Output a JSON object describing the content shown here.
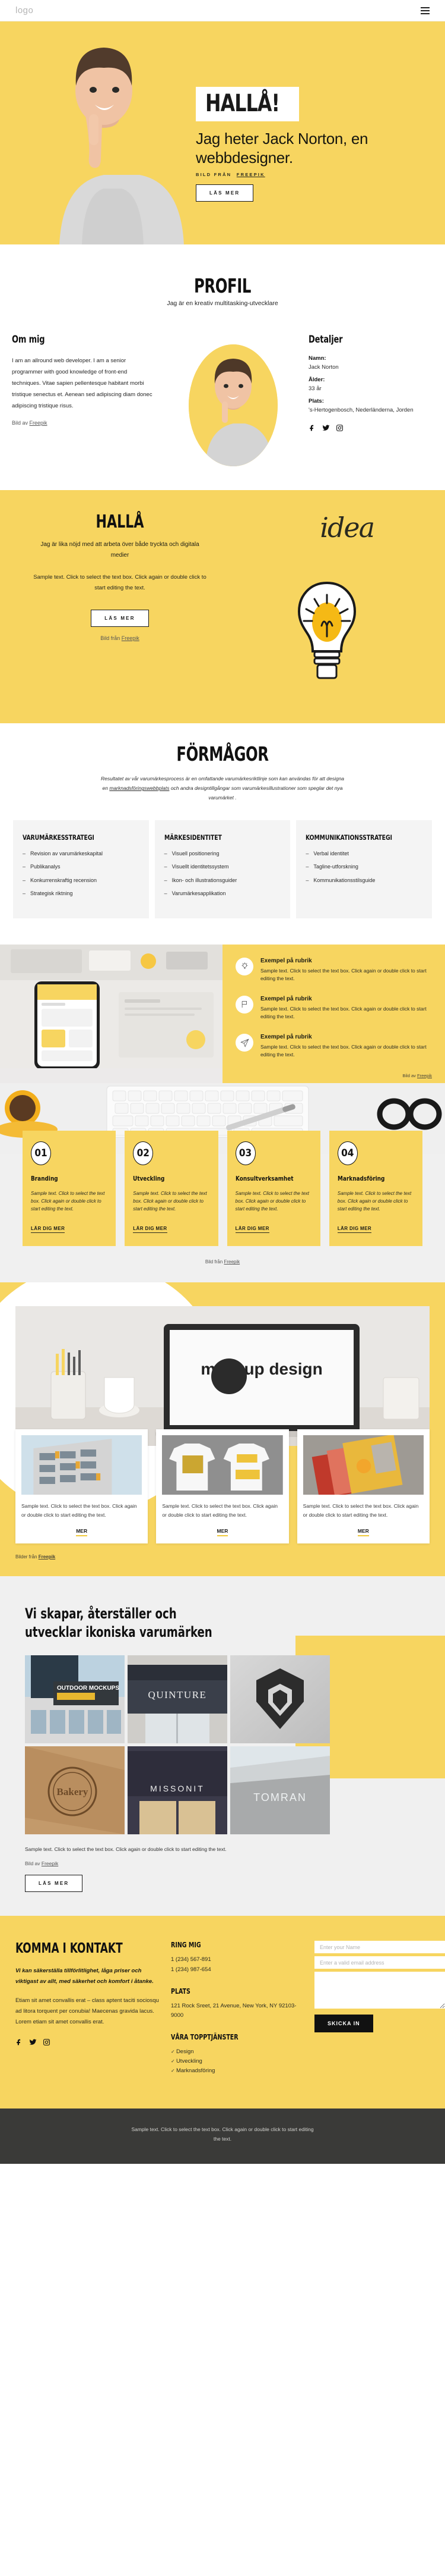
{
  "header": {
    "logo": "logo",
    "menu_icon": "hamburger-menu"
  },
  "hero": {
    "badge": "HALLÅ!",
    "headline": "Jag heter Jack Norton, en webbdesigner.",
    "credit_prefix": "BILD FRÅN",
    "credit_link": "FREEPIK",
    "cta": "LÄS MER"
  },
  "profil": {
    "title": "PROFIL",
    "subtitle": "Jag är en kreativ multitasking-utvecklare",
    "about_heading": "Om mig",
    "about_text": "I am an allround web developer. I am a senior programmer with good knowledge of front-end techniques. Vitae sapien pellentesque habitant morbi tristique senectus et. Aenean sed adipiscing diam donec adipiscing tristique risus.",
    "about_credit_prefix": "Bild av ",
    "about_credit_link": "Freepik",
    "details_heading": "Detaljer",
    "details": [
      {
        "key": "Namn:",
        "value": "Jack Norton"
      },
      {
        "key": "Ålder:",
        "value": "33 år"
      },
      {
        "key": "Plats:",
        "value": "'s-Hertogenbosch, Nederländerna, Jorden"
      }
    ],
    "socials": [
      "facebook-icon",
      "twitter-icon",
      "instagram-icon"
    ]
  },
  "halla": {
    "title": "HALLÅ",
    "tagline": "Jag är lika nöjd med att arbeta över både tryckta och digitala medier",
    "body": "Sample text. Click to select the text box. Click again or double click to start editing the text.",
    "cta": "LÄS MER",
    "credit_prefix": "Bild från ",
    "credit_link": "Freepik",
    "idea_word": "idea"
  },
  "formagor": {
    "title": "FÖRMÅGOR",
    "subtitle_a": "Resultatet av vår varumärkesprocess är en omfattande varumärkesriktlinje som kan användas för att designa en ",
    "subtitle_link": "marknadsföringswebbplats",
    "subtitle_b": " och andra designtillgångar som varumärkesillustrationer som speglar det nya varumärket .",
    "cards": [
      {
        "heading": "VARUMÄRKESSTRATEGI",
        "items": [
          "Revision av varumärkeskapital",
          "Publikanalys",
          "Konkurrenskraftig recension",
          "Strategisk riktning"
        ]
      },
      {
        "heading": "MÄRKESIDENTITET",
        "items": [
          "Visuell positionering",
          "Visuellt identitetssystem",
          "Ikon- och illustrationsguider",
          "Varumärkesapplikation"
        ]
      },
      {
        "heading": "KOMMUNIKATIONSSTRATEGI",
        "items": [
          "Verbal identitet",
          "Tagline-utforskning",
          "Kommunikationsstilsguide"
        ]
      }
    ]
  },
  "features": {
    "items": [
      {
        "icon": "lightbulb-icon",
        "title": "Exempel på rubrik",
        "text": "Sample text. Click to select the text box. Click again or double click to start editing the text."
      },
      {
        "icon": "flag-icon",
        "title": "Exempel på rubrik",
        "text": "Sample text. Click to select the text box. Click again or double click to start editing the text."
      },
      {
        "icon": "paper-plane-icon",
        "title": "Exempel på rubrik",
        "text": "Sample text. Click to select the text box. Click again or double click to start editing the text."
      }
    ],
    "credit_prefix": "Bild av ",
    "credit_link": "Freepik"
  },
  "services": {
    "cards": [
      {
        "num": "01",
        "title": "Branding",
        "text": "Sample text. Click to select the text box. Click again or double click to start editing the text.",
        "cta": "LÄR DIG MER"
      },
      {
        "num": "02",
        "title": "Utveckling",
        "text": "Sample text. Click to select the text box. Click again or double click to start editing the text.",
        "cta": "LÄR DIG MER"
      },
      {
        "num": "03",
        "title": "Konsultverksamhet",
        "text": "Sample text. Click to select the text box. Click again or double click to start editing the text.",
        "cta": "LÄR DIG MER"
      },
      {
        "num": "04",
        "title": "Marknadsföring",
        "text": "Sample text. Click to select the text box. Click again or double click to start editing the text.",
        "cta": "LÄR DIG MER"
      }
    ],
    "credit_prefix": "Bild från ",
    "credit_link": "Freepik"
  },
  "portfolio": {
    "cards": [
      {
        "text": "Sample text. Click to select the text box. Click again or double click to start editing the text.",
        "cta": "MER"
      },
      {
        "text": "Sample text. Click to select the text box. Click again or double click to start editing the text.",
        "cta": "MER"
      },
      {
        "text": "Sample text. Click to select the text box. Click again or double click to start editing the text.",
        "cta": "MER"
      }
    ],
    "credit_prefix": "Bilder från ",
    "credit_link": "Freepik",
    "mockup_label": "mockup design"
  },
  "brands": {
    "heading": "Vi skapar, återställer och utvecklar ikoniska varumärken",
    "tiles": [
      "OUTDOOR MOCKUPS",
      "QUINTURE",
      "lion-logo",
      "Bakery",
      "MISSONIT",
      "TOMRAN"
    ],
    "text": "Sample text. Click to select the text box. Click again or double click to start editing the text.",
    "credit_prefix": "Bild av ",
    "credit_link": "Freepik",
    "cta": "LÄS MER"
  },
  "contact": {
    "heading": "KOMMA I KONTAKT",
    "lead": "Vi kan säkerställa tillförlitlighet, låga priser och viktigast av allt, med säkerhet och komfort i åtanke.",
    "body": "Etiam sit amet convallis erat – class aptent taciti sociosqu ad litora torquent per conubia! Maecenas gravida lacus. Lorem etiam sit amet convallis erat.",
    "socials": [
      "facebook-icon",
      "twitter-icon",
      "instagram-icon"
    ],
    "call_heading": "RING MIG",
    "phones": [
      "1 (234) 567-891",
      "1 (234) 987-654"
    ],
    "place_heading": "PLATS",
    "address": "121 Rock Sreet, 21 Avenue, New York, NY 92103-9000",
    "services_heading": "VÅRA TOPPTJÄNSTER",
    "services": [
      "Design",
      "Utveckling",
      "Marknadsföring"
    ],
    "form": {
      "name_placeholder": "Enter your Name",
      "email_placeholder": "Enter a valid email address",
      "message_placeholder": "",
      "submit": "SKICKA IN"
    }
  },
  "footer": {
    "text": "Sample text. Click to select the text box. Click again or double click to start editing the text."
  }
}
